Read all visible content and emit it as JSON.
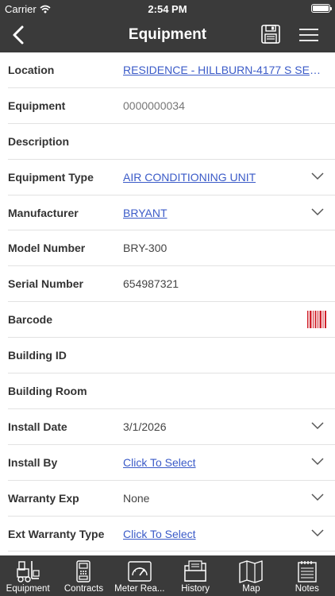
{
  "status_bar": {
    "carrier": "Carrier",
    "time": "2:54 PM",
    "battery_level": 1.0
  },
  "header": {
    "title": "Equipment"
  },
  "fields": [
    {
      "label": "Location",
      "value": "RESIDENCE - HILLBURN-4177 S SEC...",
      "style": "link"
    },
    {
      "label": "Equipment",
      "value": "0000000034",
      "style": "muted"
    },
    {
      "label": "Description",
      "value": "",
      "style": "plain"
    },
    {
      "label": "Equipment Type",
      "value": "AIR CONDITIONING UNIT",
      "style": "link"
    },
    {
      "label": "Manufacturer",
      "value": "BRYANT",
      "style": "link"
    },
    {
      "label": "Model Number",
      "value": "BRY-300",
      "style": "plain"
    },
    {
      "label": "Serial Number",
      "value": "654987321",
      "style": "plain"
    },
    {
      "label": "Barcode",
      "value": "",
      "style": "plain"
    },
    {
      "label": "Building ID",
      "value": "",
      "style": "plain"
    },
    {
      "label": "Building Room",
      "value": "",
      "style": "plain"
    },
    {
      "label": "Install Date",
      "value": "3/1/2026",
      "style": "plain"
    },
    {
      "label": "Install By",
      "value": "Click To Select",
      "style": "link"
    },
    {
      "label": "Warranty Exp",
      "value": "None",
      "style": "plain"
    },
    {
      "label": "Ext Warranty Type",
      "value": "Click To Select",
      "style": "link"
    }
  ],
  "tabs": [
    {
      "label": "Equipment",
      "icon": "forklift-icon"
    },
    {
      "label": "Contracts",
      "icon": "contract-machine-icon"
    },
    {
      "label": "Meter Rea...",
      "icon": "meter-gauge-icon"
    },
    {
      "label": "History",
      "icon": "folder-icon"
    },
    {
      "label": "Map",
      "icon": "map-icon"
    },
    {
      "label": "Notes",
      "icon": "notepad-icon"
    }
  ],
  "colors": {
    "bar_background": "#3a3a3a",
    "link": "#3b5bc8",
    "barcode": "#d0202a"
  }
}
